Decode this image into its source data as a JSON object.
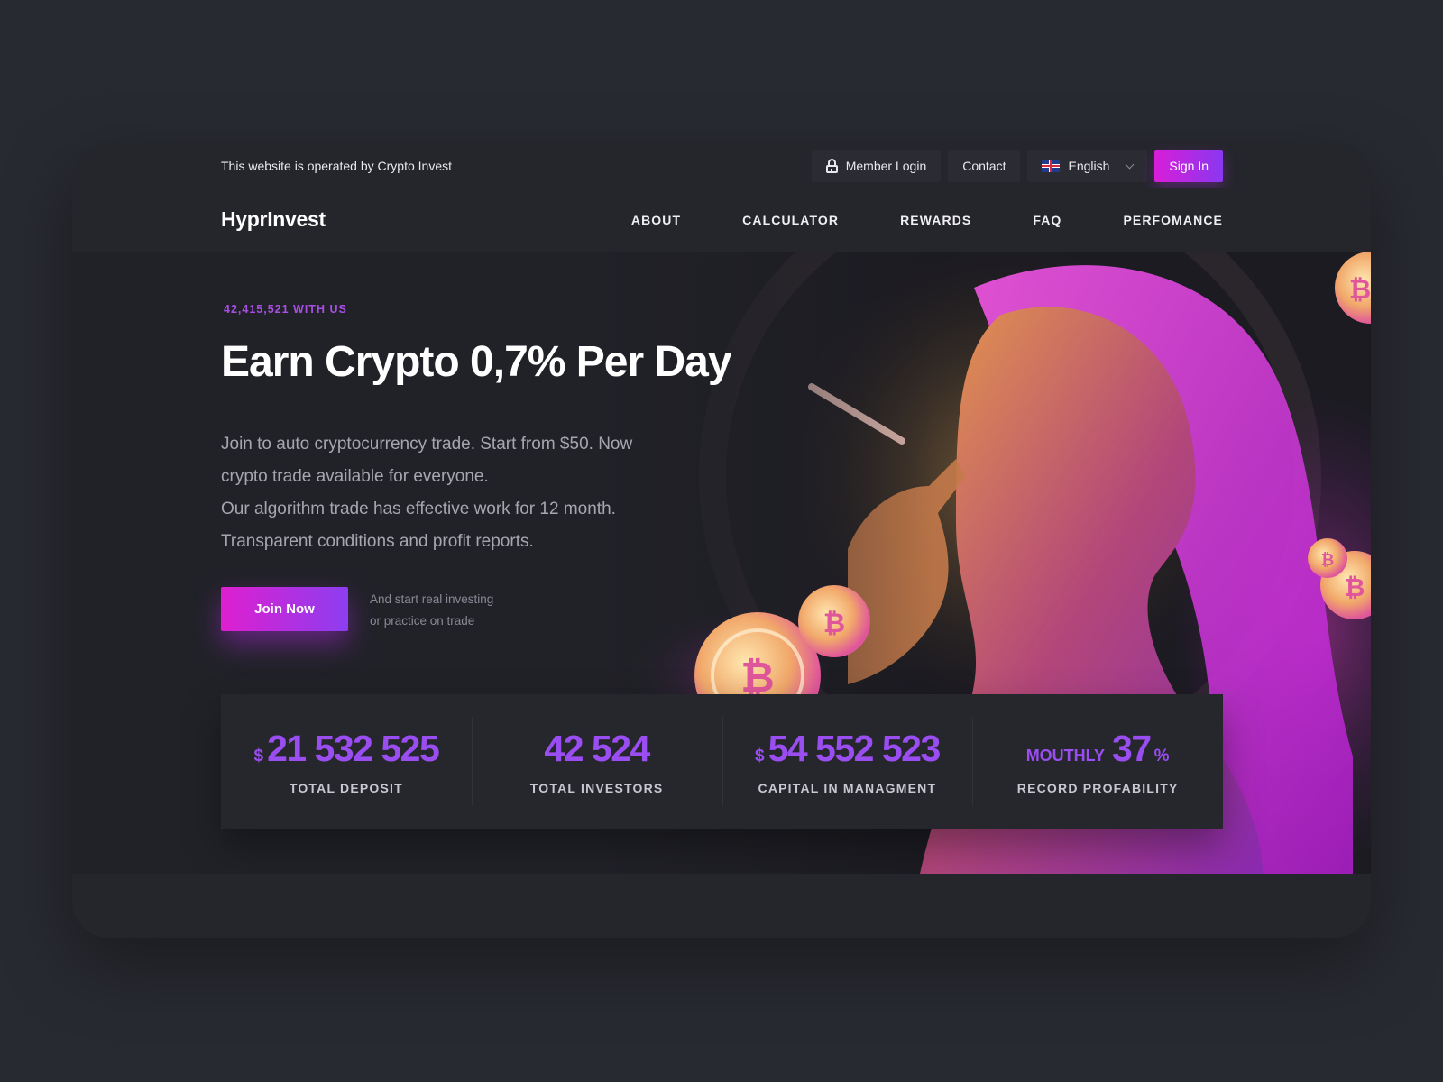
{
  "topbar": {
    "operated_text": "This website is operated by Crypto Invest",
    "member_login": "Member Login",
    "contact": "Contact",
    "language": "English",
    "sign_in": "Sign In"
  },
  "nav": {
    "logo": "HyprInvest",
    "links": [
      "ABOUT",
      "CALCULATOR",
      "REWARDS",
      "FAQ",
      "PERFOMANCE"
    ]
  },
  "hero": {
    "badge": "42,415,521 WITH US",
    "headline": "Earn Crypto 0,7% Per Day",
    "description": [
      "Join to auto cryptocurrency trade. Start from $50. Now",
      "crypto trade available for everyone.",
      "Our algorithm trade has effective work for 12 month.",
      "Transparent conditions and profit reports."
    ],
    "join_button": "Join Now",
    "join_note": [
      "And start real investing",
      "or practice on trade"
    ]
  },
  "stats": [
    {
      "prefix": "$",
      "value": "21 532 525",
      "suffix": "",
      "label": "TOTAL DEPOSIT"
    },
    {
      "prefix": "",
      "value": "42 524",
      "suffix": "",
      "label": "TOTAL INVESTORS"
    },
    {
      "prefix": "$",
      "value": "54 552 523",
      "suffix": "",
      "label": "CAPITAL IN MANAGMENT"
    },
    {
      "prefix": "MOUTHLY",
      "value": "37",
      "suffix": "%",
      "label": "RECORD PROFABILITY"
    }
  ],
  "colors": {
    "accent_pink": "#de1fcf",
    "accent_purple": "#8c3ef0",
    "stat_purple": "#9a4df0",
    "background": "#282a31"
  },
  "icons": {
    "lock": "lock-icon",
    "flag": "uk-flag-icon",
    "dropdown": "chevron-down-icon",
    "coin": "bitcoin-icon"
  }
}
